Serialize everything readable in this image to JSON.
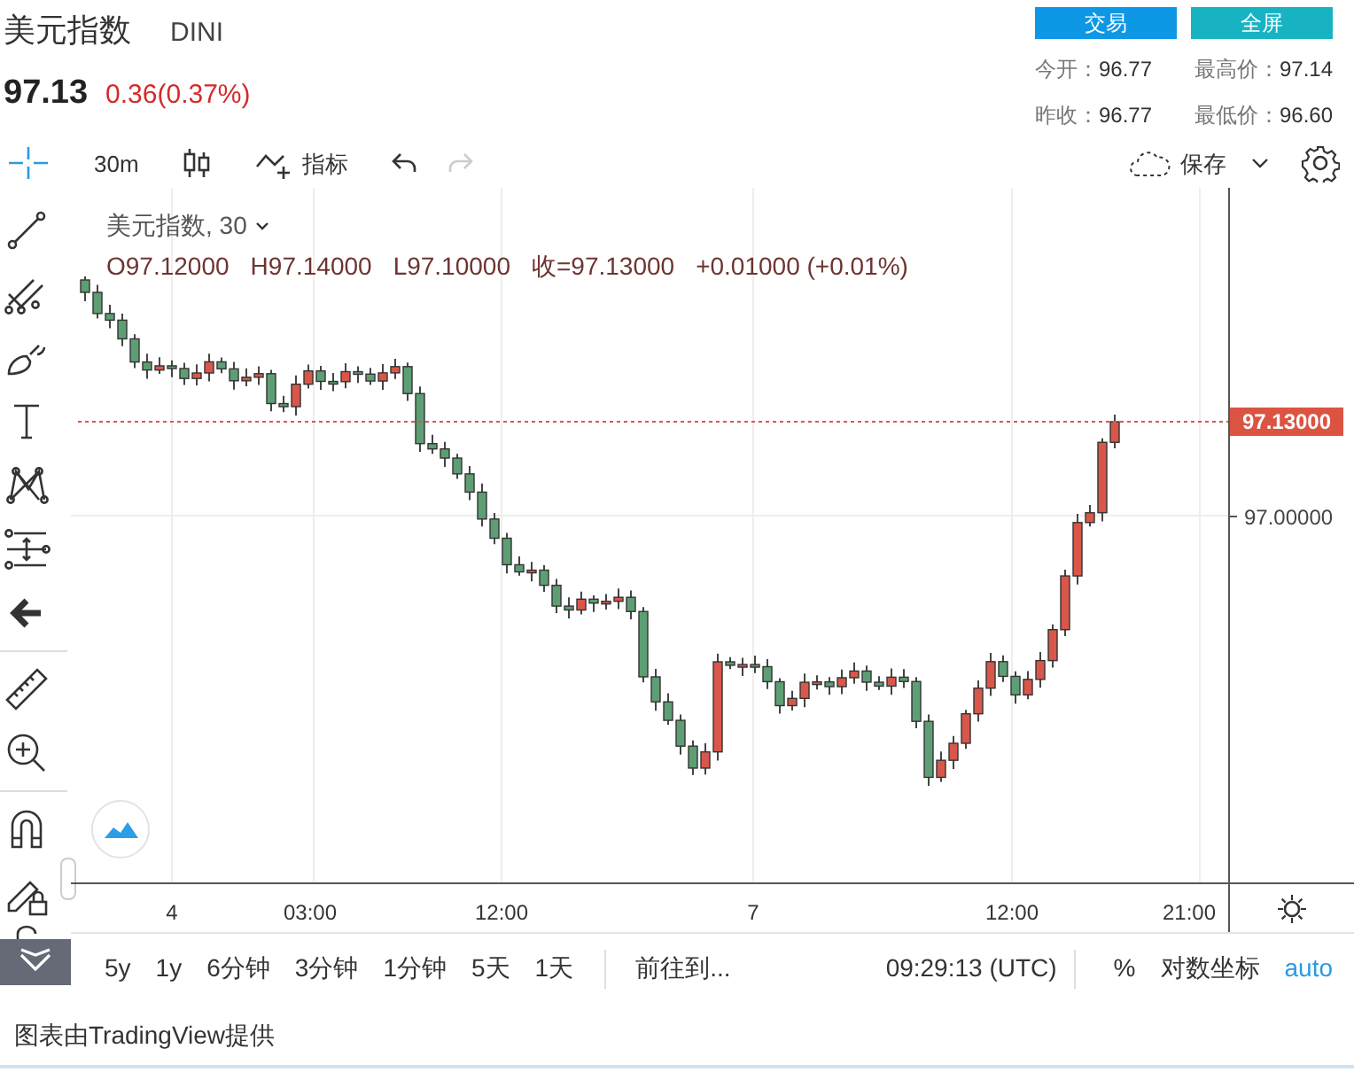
{
  "header": {
    "title": "美元指数",
    "symbol": "DINI",
    "price": "97.13",
    "change": "0.36(0.37%)",
    "buttons": [
      {
        "label": "交易",
        "kind": "trade"
      },
      {
        "label": "全屏",
        "kind": "fullscreen"
      }
    ],
    "stats": [
      {
        "label": "今开：",
        "value": "96.77"
      },
      {
        "label": "最高价：",
        "value": "97.14"
      },
      {
        "label": "昨收：",
        "value": "96.77"
      },
      {
        "label": "最低价：",
        "value": "96.60"
      }
    ]
  },
  "toolbar": {
    "interval": "30m",
    "indicators": "指标",
    "save": "保存"
  },
  "legend": {
    "title": "美元指数, 30",
    "values": [
      "O97.12000",
      "H97.14000",
      "L97.10000",
      "收=97.13000",
      "+0.01000 (+0.01%)"
    ]
  },
  "price_axis": {
    "current": "97.13000",
    "ticks": [
      "97.00000"
    ]
  },
  "time_axis": {
    "labels": [
      "4",
      "03:00",
      "12:00",
      "7",
      "12:00",
      "21:00"
    ]
  },
  "bottom_bar": {
    "ranges": [
      "5y",
      "1y",
      "6分钟",
      "3分钟",
      "1分钟",
      "5天",
      "1天"
    ],
    "goto": "前往到...",
    "clock": "09:29:13 (UTC)",
    "percent": "%",
    "log": "对数坐标",
    "auto": "auto"
  },
  "footer": "图表由TradingView提供"
}
